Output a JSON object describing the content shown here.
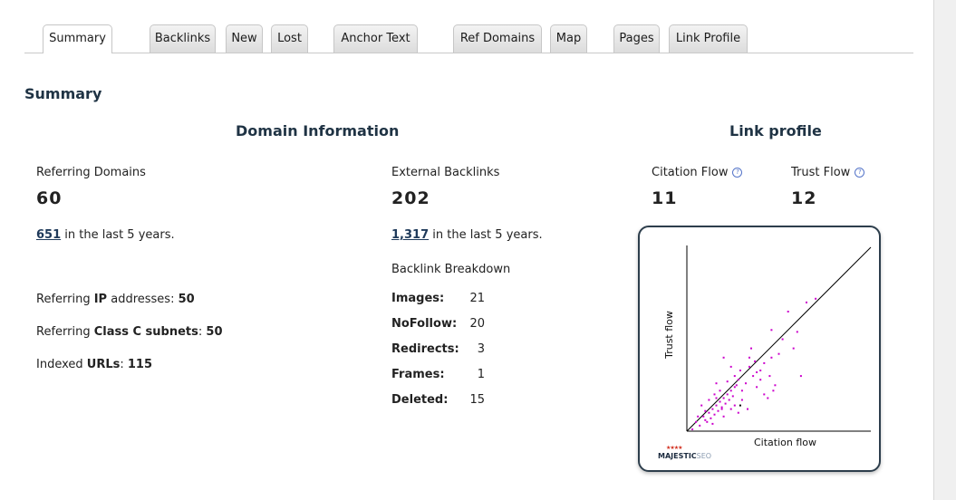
{
  "tabs": [
    {
      "label": "Summary",
      "active": true
    },
    {
      "label": "Backlinks"
    },
    {
      "label": "New"
    },
    {
      "label": "Lost"
    },
    {
      "label": "Anchor Text"
    },
    {
      "label": "Ref Domains"
    },
    {
      "label": "Map"
    },
    {
      "label": "Pages"
    },
    {
      "label": "Link Profile"
    }
  ],
  "section_title": "Summary",
  "domain_info": {
    "title": "Domain Information",
    "referring_domains": {
      "label": "Referring Domains",
      "value": "60",
      "history_link": "651",
      "history_suffix": " in the last 5 years."
    },
    "external_backlinks": {
      "label": "External Backlinks",
      "value": "202",
      "history_link": "1,317",
      "history_suffix": " in the last 5 years."
    },
    "referring_ip": {
      "prefix": "Referring ",
      "bold": "IP",
      "middle": " addresses: ",
      "value": "50"
    },
    "class_c": {
      "prefix": "Referring ",
      "bold": "Class C subnets",
      "middle": ": ",
      "value": "50"
    },
    "indexed_urls": {
      "prefix": "Indexed ",
      "bold": "URLs",
      "middle": ": ",
      "value": "115"
    },
    "breakdown": {
      "title": "Backlink Breakdown",
      "rows": [
        {
          "label": "Images:",
          "value": "21"
        },
        {
          "label": "NoFollow:",
          "value": "20"
        },
        {
          "label": "Redirects:",
          "value": "3"
        },
        {
          "label": "Frames:",
          "value": "1"
        },
        {
          "label": "Deleted:",
          "value": "15"
        }
      ]
    }
  },
  "link_profile": {
    "title": "Link profile",
    "citation_flow": {
      "label": "Citation Flow",
      "value": "11"
    },
    "trust_flow": {
      "label": "Trust Flow",
      "value": "12"
    },
    "help_glyph": "?",
    "chart": {
      "xlabel": "Citation flow",
      "ylabel": "Trust flow",
      "logo": "MAJESTIC",
      "logo_suffix": "SEO",
      "logo_stars": "★★★★",
      "point_color": "#cc00cc",
      "marker_color": "#000000"
    }
  },
  "chart_data": {
    "type": "scatter",
    "xlabel": "Citation flow",
    "ylabel": "Trust flow",
    "xlim": [
      0,
      100
    ],
    "ylim": [
      0,
      100
    ],
    "diagonal": true,
    "series": [
      {
        "points": [
          [
            3,
            1
          ],
          [
            5,
            5
          ],
          [
            7,
            3
          ],
          [
            9,
            8
          ],
          [
            10,
            6
          ],
          [
            11,
            5
          ],
          [
            12,
            10
          ],
          [
            13,
            7
          ],
          [
            14,
            12
          ],
          [
            15,
            9
          ],
          [
            16,
            14
          ],
          [
            17,
            11
          ],
          [
            18,
            16
          ],
          [
            19,
            13
          ],
          [
            20,
            18
          ],
          [
            21,
            15
          ],
          [
            22,
            20
          ],
          [
            23,
            17
          ],
          [
            24,
            22
          ],
          [
            25,
            19
          ],
          [
            26,
            24
          ],
          [
            27,
            25
          ],
          [
            8,
            14
          ],
          [
            10,
            11
          ],
          [
            12,
            17
          ],
          [
            14,
            4
          ],
          [
            16,
            26
          ],
          [
            18,
            22
          ],
          [
            20,
            8
          ],
          [
            22,
            27
          ],
          [
            24,
            12
          ],
          [
            26,
            30
          ],
          [
            28,
            28
          ],
          [
            30,
            22
          ],
          [
            32,
            26
          ],
          [
            34,
            35
          ],
          [
            36,
            30
          ],
          [
            38,
            24
          ],
          [
            40,
            28
          ],
          [
            42,
            37
          ],
          [
            35,
            45
          ],
          [
            42,
            20
          ],
          [
            44,
            18
          ],
          [
            45,
            30
          ],
          [
            46,
            40
          ],
          [
            48,
            25
          ],
          [
            50,
            42
          ],
          [
            52,
            50
          ],
          [
            55,
            65
          ],
          [
            60,
            54
          ],
          [
            20,
            40
          ],
          [
            34,
            40
          ],
          [
            30,
            17
          ],
          [
            38,
            32
          ],
          [
            28,
            10
          ],
          [
            16,
            18
          ],
          [
            26,
            14
          ],
          [
            24,
            35
          ],
          [
            33,
            12
          ],
          [
            40,
            33
          ],
          [
            46,
            55
          ],
          [
            58,
            45
          ],
          [
            62,
            30
          ],
          [
            65,
            70
          ],
          [
            70,
            72
          ],
          [
            6,
            8
          ],
          [
            19,
            12
          ],
          [
            15,
            20
          ],
          [
            29,
            33
          ],
          [
            37,
            38
          ],
          [
            47,
            22
          ]
        ]
      },
      {
        "points": [
          [
            29,
            14
          ]
        ]
      }
    ]
  }
}
